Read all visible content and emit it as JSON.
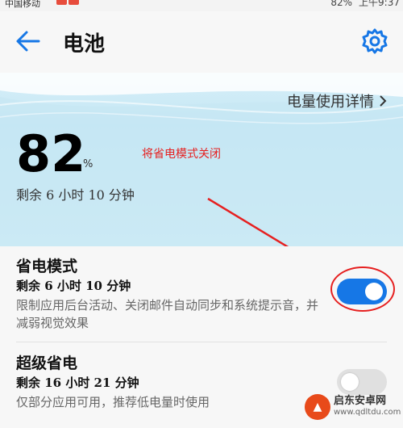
{
  "status_bar": {
    "carrier": "中国移动",
    "battery": "82%",
    "time": "上午9:37"
  },
  "header": {
    "title": "电池",
    "back_icon": "back-arrow-icon",
    "settings_icon": "gear-icon"
  },
  "hero": {
    "usage_link": "电量使用详情",
    "battery_level": "82",
    "battery_unit": "%",
    "remaining": "剩余 6 小时 10 分钟",
    "annotation": "将省电模式关闭"
  },
  "power_saving": {
    "title": "省电模式",
    "remaining": "剩余 6 小时 10 分钟",
    "description": "限制应用后台活动、关闭邮件自动同步和系统提示音，并减弱视觉效果",
    "enabled": true
  },
  "super_saving": {
    "title": "超级省电",
    "remaining": "剩余 16 小时 21 分钟",
    "description": "仅部分应用可用，推荐低电量时使用",
    "enabled": false
  },
  "watermark": {
    "name": "启东安卓网",
    "url": "www.qdltdu.com"
  },
  "colors": {
    "accent": "#1677e6",
    "annotation": "#e62020"
  }
}
